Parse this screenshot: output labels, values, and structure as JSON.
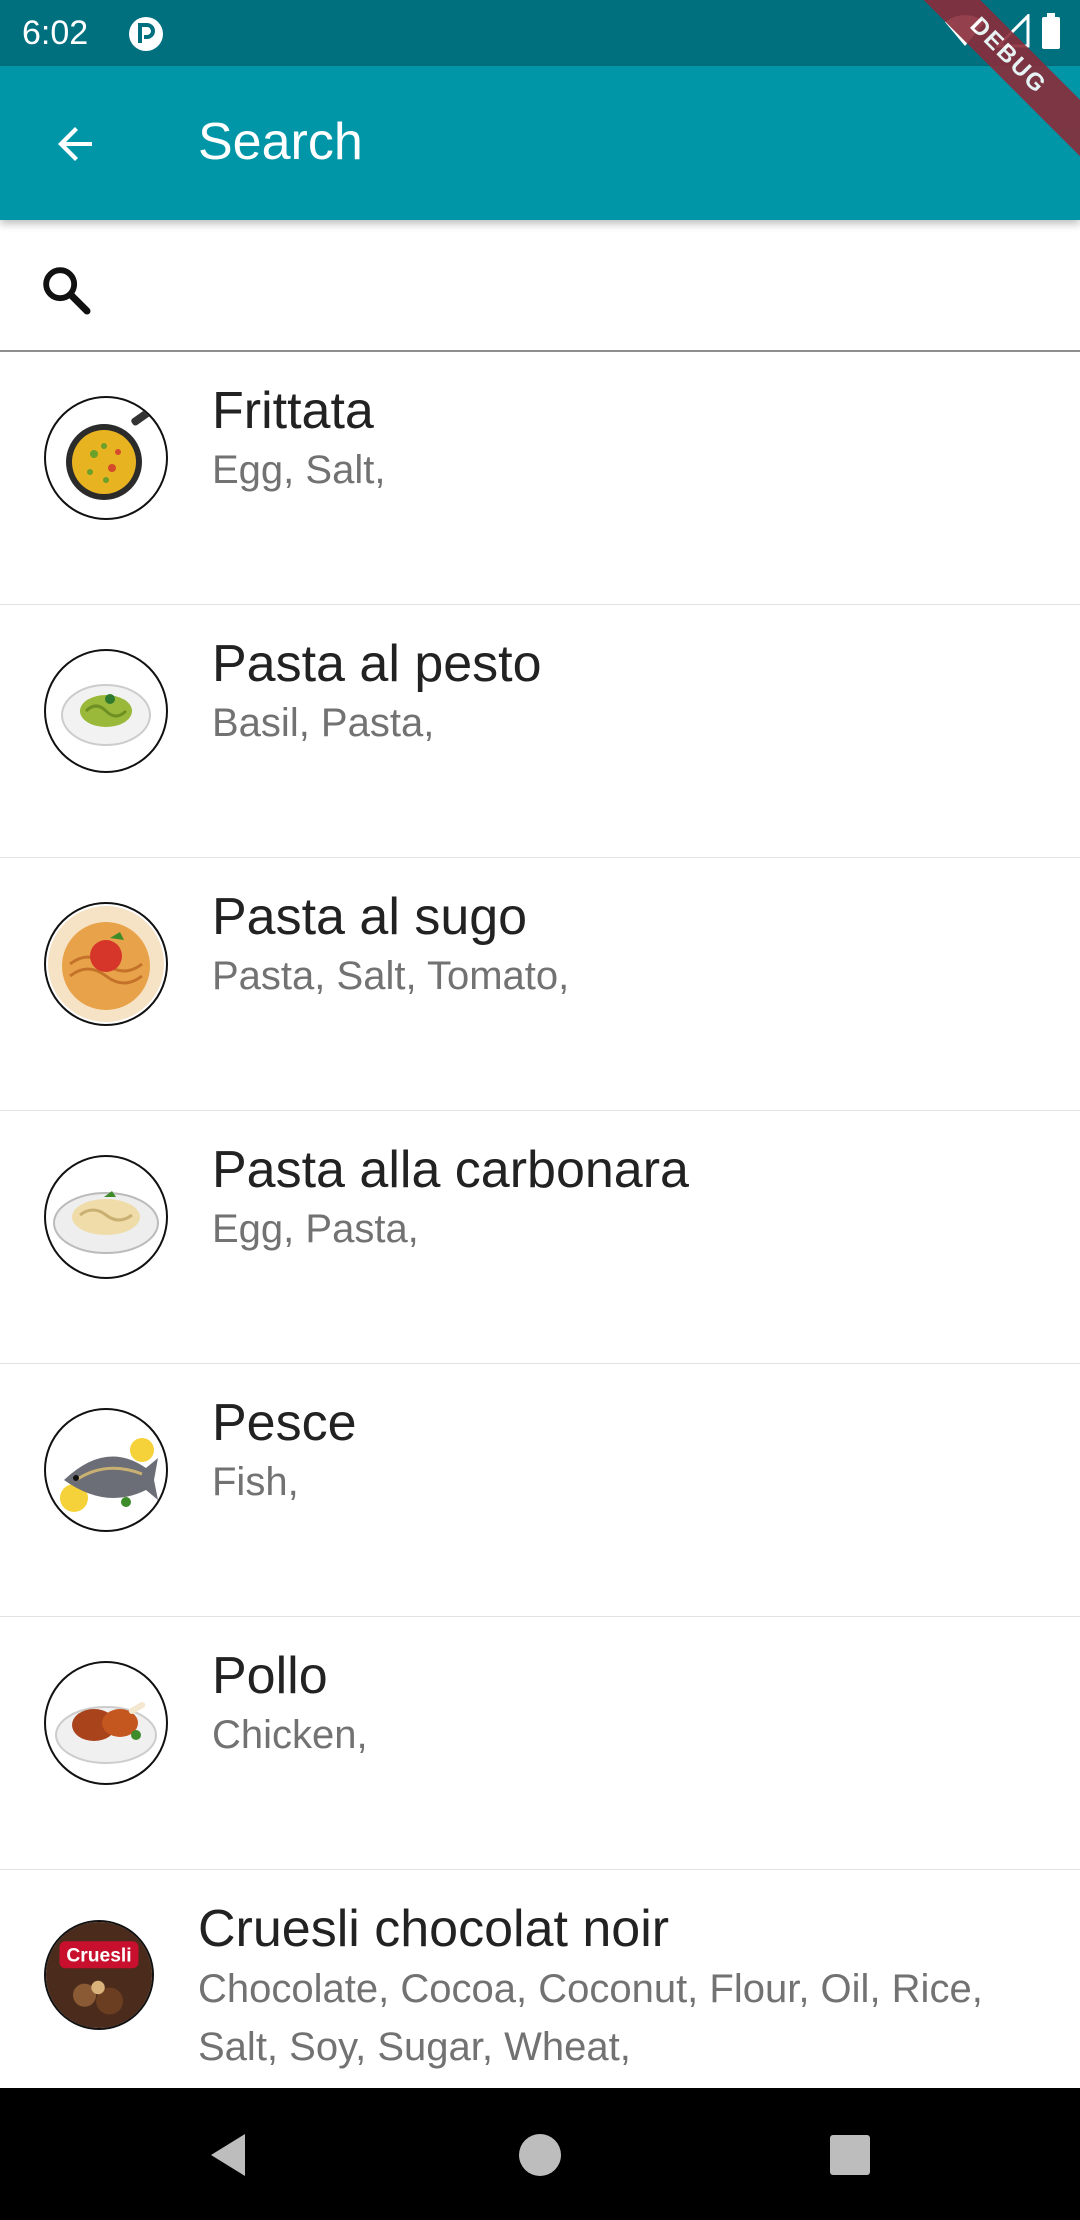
{
  "status_bar": {
    "time": "6:02"
  },
  "debug_banner": "DEBUG",
  "app_bar": {
    "title": "Search",
    "back_icon": "arrow-back-icon"
  },
  "search": {
    "value": "",
    "placeholder": "",
    "icon": "search-icon"
  },
  "recipes": [
    {
      "title": "Frittata",
      "ingredients": "Egg, Salt,"
    },
    {
      "title": "Pasta al pesto",
      "ingredients": "Basil, Pasta,"
    },
    {
      "title": "Pasta al sugo",
      "ingredients": "Pasta, Salt, Tomato,"
    },
    {
      "title": "Pasta alla carbonara",
      "ingredients": "Egg, Pasta,"
    },
    {
      "title": "Pesce",
      "ingredients": "Fish,"
    },
    {
      "title": "Pollo",
      "ingredients": "Chicken,"
    },
    {
      "title": "Cruesli chocolat noir",
      "ingredients": "Chocolate, Cocoa, Coconut, Flour, Oil, Rice, Salt, Soy, Sugar, Wheat,",
      "logo_text": "Cruesli"
    }
  ],
  "colors": {
    "status_bar": "#00707f",
    "app_bar": "#0096a7",
    "debug_banner": "#8a2c3a"
  }
}
